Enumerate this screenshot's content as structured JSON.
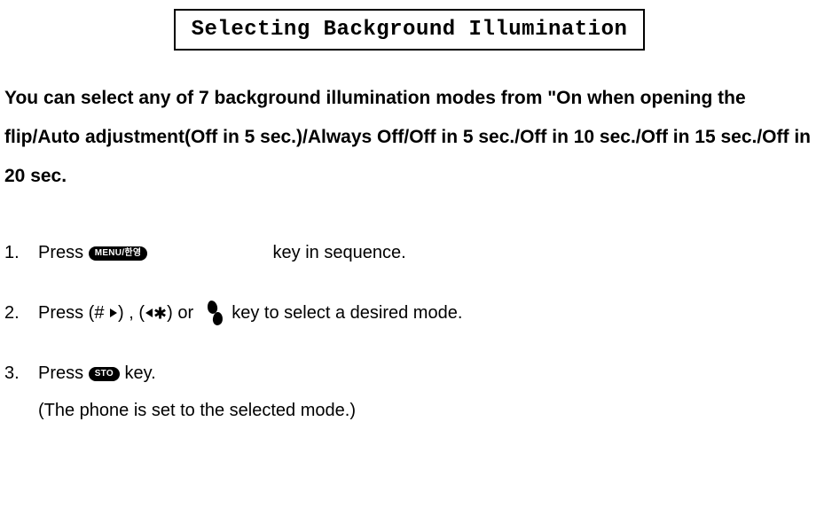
{
  "title": "Selecting Background Illumination",
  "intro": "You can select any of 7 background illumination modes from \"On when opening the flip/Auto adjustment(Off in 5 sec.)/Always Off/Off in 5 sec./Off in 10 sec./Off in 15 sec./Off in 20 sec.",
  "steps": {
    "s1": {
      "pre": "Press ",
      "key": "MENU/한영",
      "post": " key in sequence."
    },
    "s2": {
      "pre": "Press (# ",
      "mid1": ") , (",
      "mid2": ") or   ",
      "post": " key to select a desired mode."
    },
    "s3": {
      "pre": "Press ",
      "key": "STO",
      "post": " key.",
      "note": "(The phone is set to the selected mode.)"
    }
  },
  "glyphs": {
    "star": "✱"
  }
}
